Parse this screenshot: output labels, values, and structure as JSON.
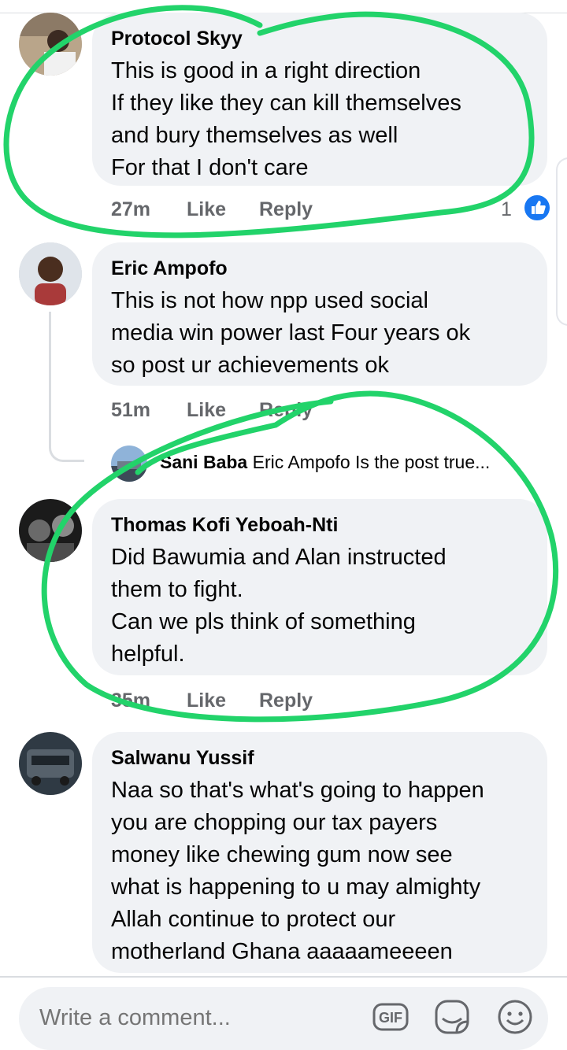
{
  "comments": [
    {
      "author": "Protocol Skyy",
      "text": "This is good in a right direction\nIf they like they can kill themselves\nand bury themselves as well\nFor that I don't care",
      "time": "27m",
      "like": "Like",
      "reply": "Reply",
      "reaction_count": "1"
    },
    {
      "author": "Eric Ampofo",
      "text": "This is not how npp used social\nmedia win power last Four years ok\nso post ur achievements ok",
      "time": "51m",
      "like": "Like",
      "reply": "Reply"
    },
    {
      "author": "Thomas Kofi Yeboah-Nti",
      "text": "Did Bawumia and Alan instructed\nthem to fight.\nCan we pls think of something\nhelpful.",
      "time": "35m",
      "like": "Like",
      "reply": "Reply"
    },
    {
      "author": "Salwanu Yussif",
      "text": "Naa so that's what's going to happen\nyou are chopping our tax payers\nmoney like chewing gum now see\nwhat is happening to u may almighty\nAllah continue to protect our\nmotherland Ghana aaaaameeeen"
    }
  ],
  "reply_preview": {
    "author": "Sani Baba",
    "text": "Eric Ampofo Is the post true..."
  },
  "composer": {
    "placeholder": "Write a comment...",
    "gif_label": "GIF"
  },
  "icons": [
    "like-reaction-icon",
    "gif-icon",
    "sticker-icon",
    "emoji-icon"
  ],
  "colors": {
    "bubble": "#f0f2f5",
    "meta": "#65676b",
    "like_blue": "#1877f2",
    "annotation_green": "#22d36a"
  }
}
